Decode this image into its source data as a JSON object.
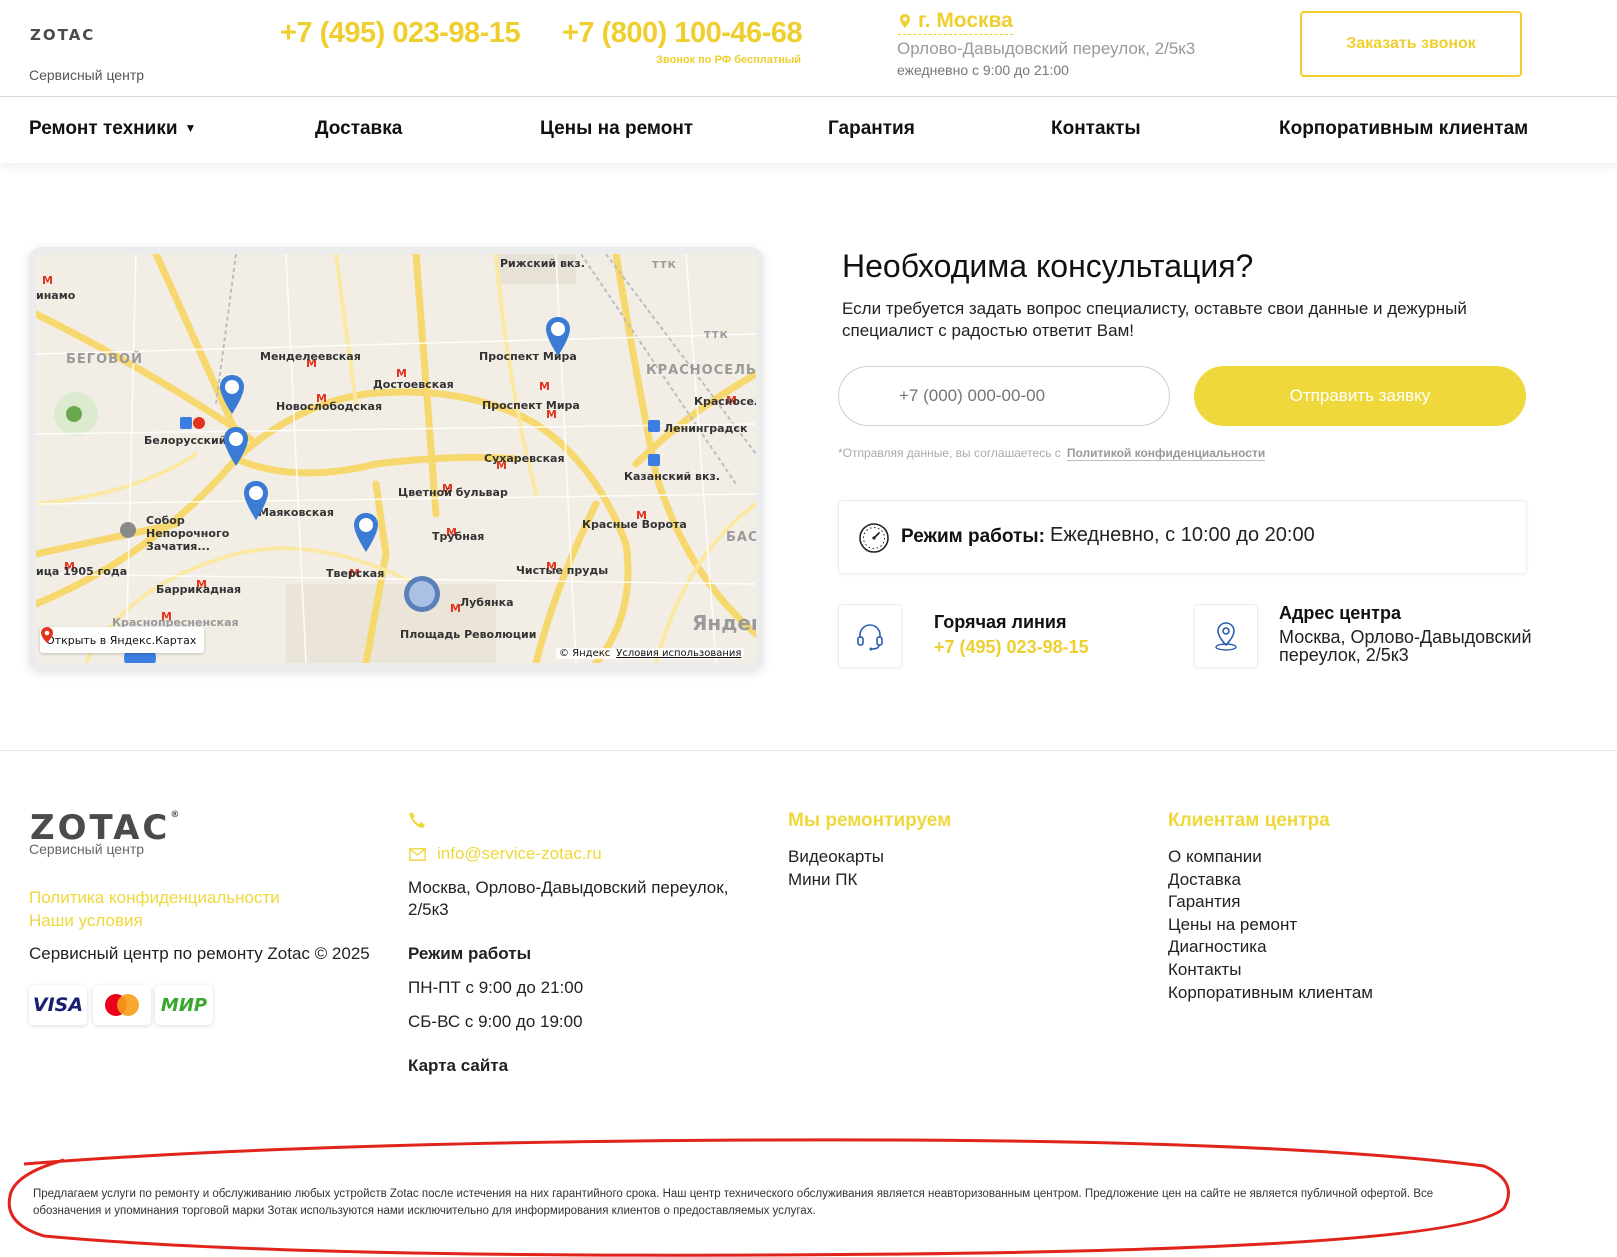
{
  "header": {
    "logo_text": "ZOTAC",
    "logo_sub": "Сервисный центр",
    "phone1": "+7 (495) 023-98-15",
    "phone2": "+7 (800) 100-46-68",
    "phone2_note": "Звонок по РФ бесплатный",
    "city": "г. Москва",
    "address": "Орлово-Давыдовский переулок, 2/5к3",
    "hours": "ежедневно с 9:00 до 21:00",
    "callback_label": "Заказать звонок"
  },
  "nav": {
    "items": [
      {
        "label": "Ремонт техники"
      },
      {
        "label": "Доставка"
      },
      {
        "label": "Цены на ремонт"
      },
      {
        "label": "Гарантия"
      },
      {
        "label": "Контакты"
      },
      {
        "label": "Корпоративным клиентам"
      }
    ],
    "dropdown_icon": "caret-down-icon"
  },
  "map": {
    "labels": {
      "rizhsky": "Рижский вкз.",
      "beg": "БЕГОВОЙ",
      "mendeleev": "Менделеевская",
      "dostoev": "Достоевская",
      "novoslob": "Новослободская",
      "prospekt_mira1": "Проспект Мира",
      "prospekt_mira2": "Проспект Мира",
      "krasnosel": "КРАСНОСЕЛЬС",
      "krasnosel2": "Красносел",
      "leningrad": "Ленинградск",
      "belorussky": "Белорусский",
      "sukharev": "Сухаревская",
      "kazansky": "Казанский вкз.",
      "mayak": "Маяковская",
      "cvetnoy": "Цветной бульвар",
      "sobor": "Собор",
      "nepor": "Непорочного",
      "zachat": "Зачатия...",
      "trubnaya": "Трубная",
      "krasnye_vorota": "Красные Ворота",
      "ulica1905": "ица 1905 года",
      "tverskaya": "Тверская",
      "chistye": "Чистые пруды",
      "barrikad": "Баррикадная",
      "lubyanka": "Лубянка",
      "krasnopresn": "Краснопресненская",
      "pl_rev": "Площадь Революции",
      "dinamo": "инамо",
      "ttk1": "ТТК",
      "ttk2": "ТТК",
      "basm": "БАС"
    },
    "open_label": "Открыть в Яндекс.Картах",
    "brand": "Яндекс",
    "copyright": "© Яндекс",
    "terms": "Условия использования"
  },
  "consult": {
    "title": "Необходима консультация?",
    "text": "Если требуется задать вопрос специалисту, оставьте свои данные и дежурный специалист с радостью ответит Вам!",
    "phone_placeholder": "+7 (000) 000-00-00",
    "send_label": "Отправить заявку",
    "consent_text": "*Отправляя данные, вы соглашаетесь с",
    "consent_link": "Политикой конфиденциальности",
    "work_label": "Режим работы:",
    "work_value": "Ежедневно, с 10:00 до 20:00",
    "hotline_label": "Горячая линия",
    "hotline_phone": "+7 (495) 023-98-15",
    "address_label": "Адрес центра",
    "address_value": "Москва, Орлово-Давыдовский переулок, 2/5к3"
  },
  "footer": {
    "logo_text": "ZOTAC",
    "logo_sub": "Сервисный центр",
    "privacy_link": "Политика конфиденциальности",
    "terms_link": "Наши условия",
    "copyright": "Сервисный центр по ремонту Zotac © 2025",
    "payments": [
      "VISA",
      "Mastercard",
      "МИР"
    ],
    "email": "info@service-zotac.ru",
    "address": "Москва, Орлово-Давыдовский переулок, 2/5к3",
    "work_title": "Режим работы",
    "work1": "ПН-ПТ с 9:00 до 21:00",
    "work2": "СБ-ВС с 9:00 до 19:00",
    "sitemap": "Карта сайта",
    "repair_title": "Мы ремонтируем",
    "repair_items": [
      "Видеокарты",
      "Мини ПК"
    ],
    "clients_title": "Клиентам центра",
    "clients_items": [
      "О компании",
      "Доставка",
      "Гарантия",
      "Цены на ремонт",
      "Диагностика",
      "Контакты",
      "Корпоративным клиентам"
    ],
    "disclaimer": "Предлагаем услуги по ремонту и обслуживанию любых устройств Zotac после истечения на них гарантийного срока. Наш центр технического обслуживания является неавторизованным центром. Предложение цен на сайте не является публичной офертой. Все обозначения и упоминания торговой марки Зотак используются нами исключительно для информирования клиентов о предоставляемых услугах."
  },
  "colors": {
    "accent": "#efcf2f",
    "button": "#efd83b",
    "annotation": "#e0241b"
  }
}
